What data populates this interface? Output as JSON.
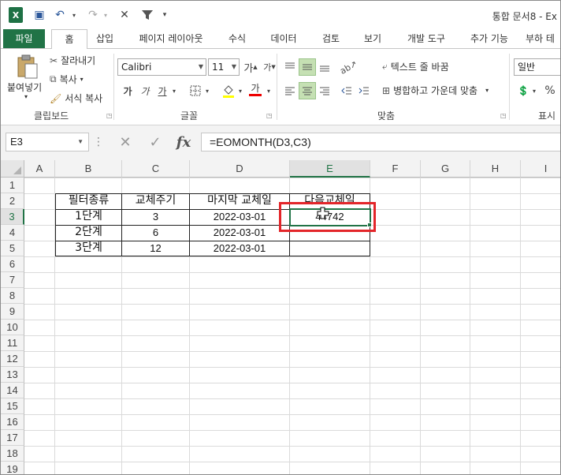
{
  "window": {
    "title": "통합 문서8 - Ex",
    "app_logo": "X"
  },
  "qat": {
    "save_icon": "💾",
    "undo_icon": "↶",
    "redo_icon": "↷",
    "close_icon": "✕",
    "filter_icon": "⏷",
    "more_icon": "▾"
  },
  "tabs": [
    "파일",
    "홈",
    "삽입",
    "페이지 레이아웃",
    "수식",
    "데이터",
    "검토",
    "보기",
    "개발 도구",
    "추가 기능",
    "부하 테"
  ],
  "ribbon": {
    "clipboard": {
      "paste_label": "붙여넣기",
      "cut_label": "잘라내기",
      "copy_label": "복사",
      "format_painter_label": "서식 복사",
      "group_label": "클립보드"
    },
    "font": {
      "font_name": "Calibri",
      "font_size": "11",
      "grow_label": "가",
      "shrink_label": "가",
      "bold_label": "가",
      "italic_label": "가",
      "underline_label": "가",
      "font_color_label": "가",
      "group_label": "글꼴"
    },
    "alignment": {
      "wrap_text_label": "텍스트 줄 바꿈",
      "merge_center_label": "병합하고 가운데 맞춤",
      "group_label": "맞춤"
    },
    "number": {
      "format_value": "일반",
      "percent_label": "%",
      "group_label": "표시"
    }
  },
  "formula_bar": {
    "name_box": "E3",
    "cancel_icon": "✕",
    "enter_icon": "✓",
    "fx_label": "fx",
    "formula": "=EOMONTH(D3,C3)"
  },
  "sheet": {
    "columns": [
      "A",
      "B",
      "C",
      "D",
      "E",
      "F",
      "G",
      "H",
      "I"
    ],
    "rows": [
      "1",
      "2",
      "3",
      "4",
      "5",
      "6",
      "7",
      "8",
      "9",
      "10",
      "11",
      "12",
      "13",
      "14",
      "15",
      "16",
      "17",
      "18",
      "19"
    ],
    "table": {
      "headers": [
        "필터종류",
        "교체주기",
        "마지막 교체일",
        "다음교체일"
      ],
      "rows": [
        [
          "1단계",
          "3",
          "2022-03-01",
          "44742"
        ],
        [
          "2단계",
          "6",
          "2022-03-01",
          ""
        ],
        [
          "3단계",
          "12",
          "2022-03-01",
          ""
        ]
      ]
    },
    "selected_cell": "E3"
  },
  "colors": {
    "excel_green": "#217346",
    "highlight_red": "#e3262a"
  }
}
